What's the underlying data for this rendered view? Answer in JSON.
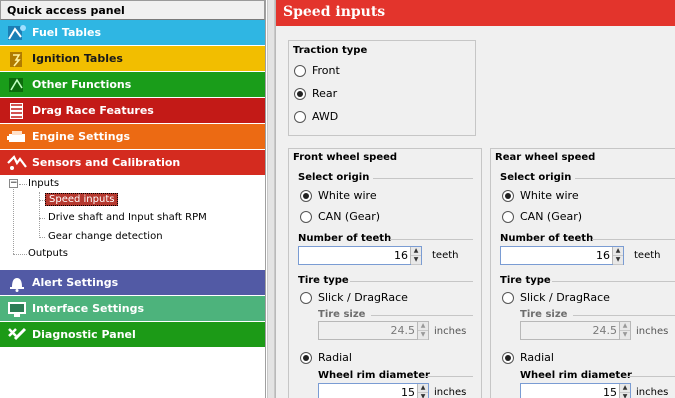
{
  "left_panel": {
    "title": "Quick access panel",
    "categories": [
      {
        "label": "Fuel Tables",
        "icon": "fuel-tables-icon"
      },
      {
        "label": "Ignition Tables",
        "icon": "ignition-tables-icon"
      },
      {
        "label": "Other Functions",
        "icon": "other-functions-icon"
      },
      {
        "label": "Drag Race Features",
        "icon": "drag-race-icon"
      },
      {
        "label": "Engine Settings",
        "icon": "engine-icon"
      },
      {
        "label": "Sensors and Calibration",
        "icon": "sensors-icon"
      },
      {
        "label": "Alert Settings",
        "icon": "alert-bell-icon"
      },
      {
        "label": "Interface Settings",
        "icon": "monitor-icon"
      },
      {
        "label": "Diagnostic Panel",
        "icon": "diagnostic-icon"
      }
    ],
    "tree": {
      "root": "Inputs",
      "children": [
        "Speed inputs",
        "Drive shaft and Input shaft RPM",
        "Gear change detection"
      ],
      "sibling": "Outputs",
      "selected": "Speed inputs"
    }
  },
  "right_panel": {
    "title": "Speed inputs",
    "traction": {
      "label": "Traction type",
      "options": [
        "Front",
        "Rear",
        "AWD"
      ],
      "selected": "Rear"
    },
    "front": {
      "label": "Front wheel speed",
      "select_origin_label": "Select origin",
      "origin_options": [
        "White wire",
        "CAN (Gear)"
      ],
      "origin_selected": "White wire",
      "teeth_label": "Number of teeth",
      "teeth_value": "16",
      "teeth_unit": "teeth",
      "tire_type_label": "Tire type",
      "tire_slick": "Slick / DragRace",
      "tire_size_label": "Tire size",
      "tire_size_value": "24.5",
      "tire_size_unit": "inches",
      "radial": "Radial",
      "rim_label": "Wheel rim diameter",
      "rim_value": "15",
      "rim_unit": "inches"
    },
    "rear": {
      "label": "Rear wheel speed",
      "select_origin_label": "Select origin",
      "origin_options": [
        "White wire",
        "CAN (Gear)"
      ],
      "origin_selected": "White wire",
      "teeth_label": "Number of teeth",
      "teeth_value": "16",
      "teeth_unit": "teeth",
      "tire_type_label": "Tire type",
      "tire_slick": "Slick / DragRace",
      "tire_size_label": "Tire size",
      "tire_size_value": "24.5",
      "tire_size_unit": "inches",
      "radial": "Radial",
      "rim_label": "Wheel rim diameter",
      "rim_value": "15",
      "rim_unit": "inches"
    }
  },
  "colors": {
    "title_red": "#e3342c",
    "selected_node": "#b5382e",
    "fuel": "#2fb6e3",
    "ignition": "#f2be00",
    "other": "#1a9d1a",
    "drag": "#c31a17",
    "engine": "#ec6a13",
    "sensors": "#d42b1f",
    "alert": "#525aa5",
    "interface": "#4db37c",
    "diagnostic": "#1c9a17"
  }
}
